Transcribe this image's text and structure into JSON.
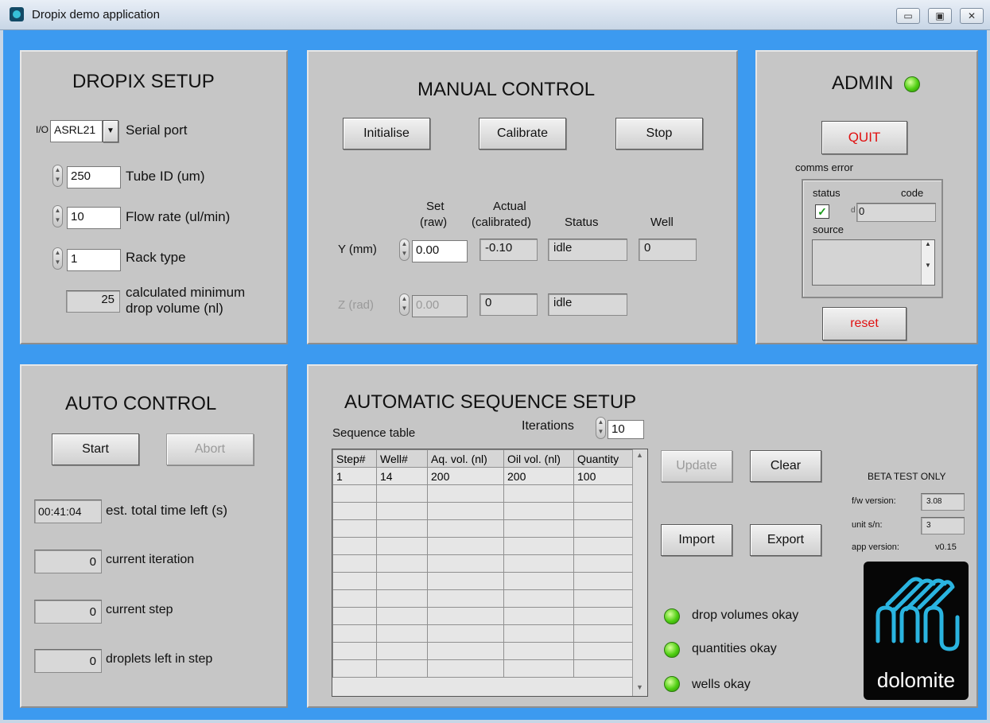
{
  "window": {
    "title": "Dropix demo application",
    "minimize": "▭",
    "maximize": "▣",
    "close": "✕"
  },
  "setup": {
    "title": "DROPIX SETUP",
    "serial_prefix": "I/O",
    "serial_value": "ASRL21",
    "serial_label": "Serial port",
    "tube_id_value": "250",
    "tube_id_label": "Tube ID (um)",
    "flow_value": "10",
    "flow_label": "Flow rate (ul/min)",
    "rack_value": "1",
    "rack_label": "Rack type",
    "min_drop_value": "25",
    "min_drop_label_1": "calculated minimum",
    "min_drop_label_2": "drop volume (nl)"
  },
  "manual": {
    "title": "MANUAL CONTROL",
    "initialise": "Initialise",
    "calibrate": "Calibrate",
    "stop": "Stop",
    "col_set_1": "Set",
    "col_set_2": "(raw)",
    "col_actual_1": "Actual",
    "col_actual_2": "(calibrated)",
    "col_status": "Status",
    "col_well": "Well",
    "y_label": "Y (mm)",
    "y_set": "0.00",
    "y_actual": "-0.10",
    "y_status": "idle",
    "y_well": "0",
    "z_label": "Z (rad)",
    "z_set": "0.00",
    "z_actual": "0",
    "z_status": "idle"
  },
  "admin": {
    "title": "ADMIN",
    "quit": "QUIT",
    "comms_error": "comms error",
    "status_label": "status",
    "code_label": "code",
    "code_prefix": "d",
    "code_value": "0",
    "source_label": "source",
    "reset": "reset",
    "led_color": "#4fcf12"
  },
  "auto": {
    "title": "AUTO CONTROL",
    "start": "Start",
    "abort": "Abort",
    "time_left_value": "00:41:04",
    "time_left_label": "est. total time left (s)",
    "iteration_value": "0",
    "iteration_label": "current iteration",
    "step_value": "0",
    "step_label": "current step",
    "droplets_value": "0",
    "droplets_label": "droplets left in step"
  },
  "sequence": {
    "title": "AUTOMATIC SEQUENCE SETUP",
    "table_label": "Sequence table",
    "iterations_label": "Iterations",
    "iterations_value": "10",
    "columns": [
      "Step#",
      "Well#",
      "Aq. vol. (nl)",
      "Oil vol. (nl)",
      "Quantity"
    ],
    "rows": [
      [
        "1",
        "14",
        "200",
        "200",
        "100"
      ]
    ],
    "update": "Update",
    "clear": "Clear",
    "import": "Import",
    "export": "Export",
    "status_drop_volumes": "drop volumes okay",
    "status_quantities": "quantities okay",
    "status_wells": "wells okay",
    "beta": "BETA TEST ONLY",
    "fw_label": "f/w version:",
    "fw_value": "3.08",
    "sn_label": "unit s/n:",
    "sn_value": "3",
    "app_version_label": "app version:",
    "app_version_value": "v0.15",
    "logo_text": "dolomite"
  }
}
